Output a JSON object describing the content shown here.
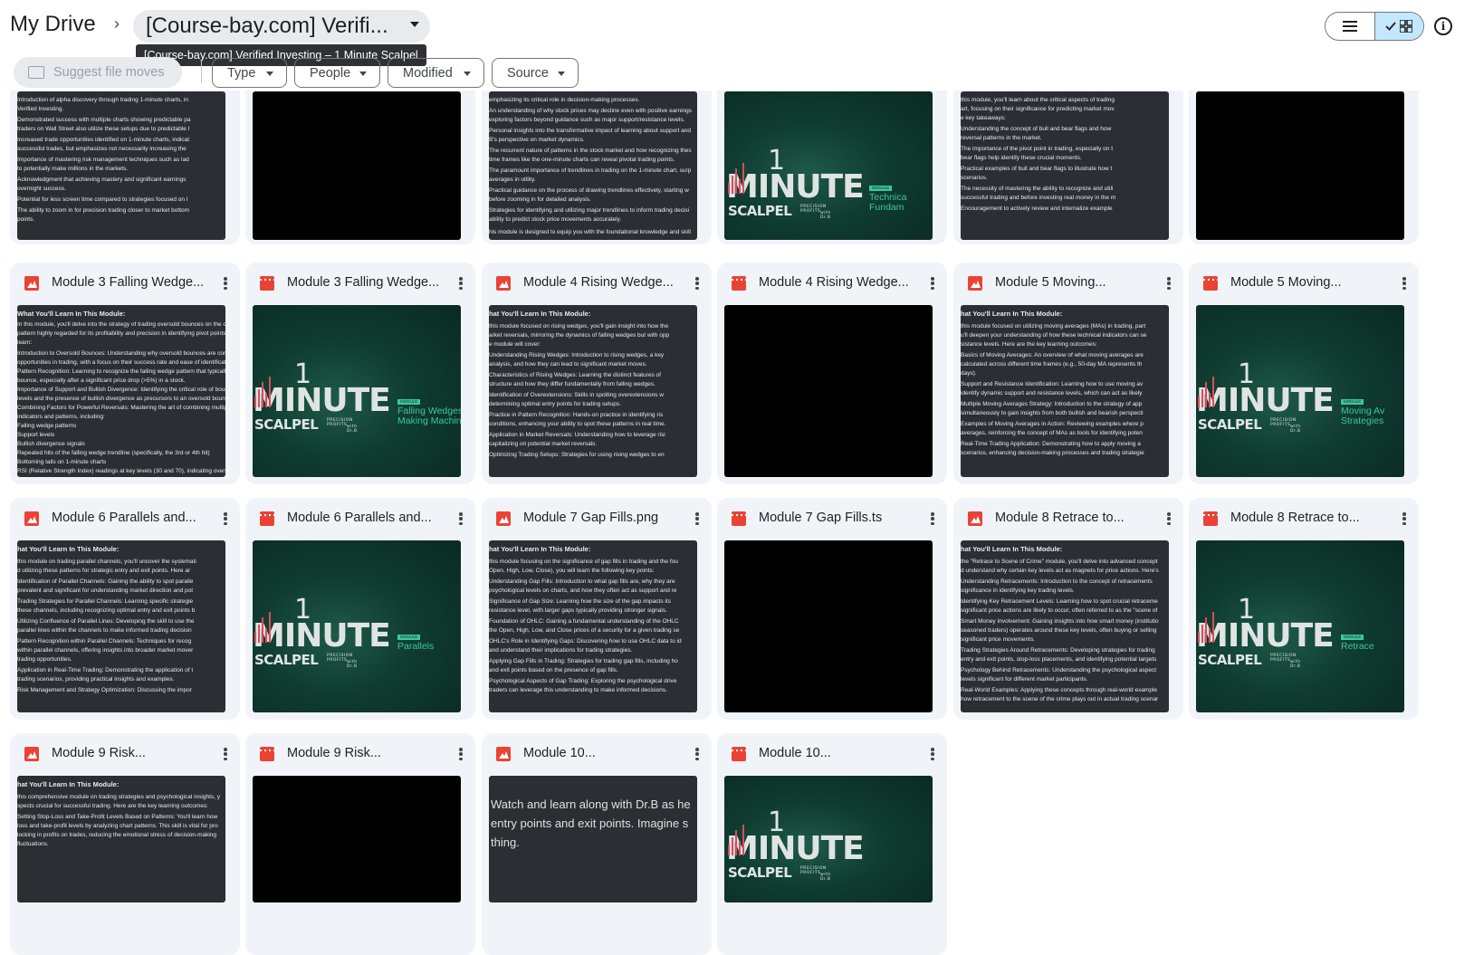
{
  "breadcrumb": {
    "root": "My Drive",
    "separator": "›",
    "current": "[Course-bay.com] Verifi...",
    "tooltip": "[Course-bay.com] Verified Investing – 1 Minute Scalpel"
  },
  "toolbar": {
    "suggest_label": "Suggest file moves",
    "filters": [
      "Type",
      "People",
      "Modified",
      "Source"
    ]
  },
  "logo": {
    "minute": "MINUTE",
    "scalpel": "SCALPEL",
    "precision": "PRECISION PROFITS",
    "with": "with Dr.B",
    "one": "1",
    "module_badge": "MODULE"
  },
  "rows": [
    {
      "cards": [
        {
          "name": "",
          "type": "image",
          "thumb": "text",
          "lines": [
            "Introduction of alpha discovery through trading 1-minute charts, in",
            "Verified Investing.",
            "",
            "Demonstrated success with multiple charts showing predictable pa",
            "traders on Wall Street also utilize these setups due to predictable l",
            "",
            "Increased trade opportunities identified on 1-minute charts, indicat",
            "successful trades, but emphasizes not necessarily increasing the",
            "",
            "Importance of mastering risk management techniques such as lad",
            "to potentially make millions in the markets.",
            "",
            "Acknowledgment that achieving mastery and significant earnings",
            "overnight success.",
            "",
            "Potential for less screen time compared to strategies focused on l",
            "",
            "The ability to zoom in for precision trading closer to market bottom",
            "points."
          ]
        },
        {
          "name": "",
          "type": "video",
          "thumb": "black"
        },
        {
          "name": "",
          "type": "image",
          "thumb": "text",
          "lines": [
            "emphasizing its critical role in decision-making processes.",
            "",
            "An understanding of why stock prices may decline even with positive earnings",
            "exploring factors beyond guidance such as major support/resistance levels.",
            "",
            "Personal insights into the transformative impact of learning about support and",
            "B's perspective on market dynamics.",
            "",
            "The recurrent nature of patterns in the stock market and how recognizing thes",
            "time frames like the one-minute charts can reveal pivotal trading points.",
            "",
            "The paramount importance of trendlines in trading on the 1-minute chart, surp",
            "averages in utility.",
            "",
            "Practical guidance on the process of drawing trendlines effectively, starting w",
            "before zooming in for detailed analysis.",
            "",
            "Strategies for identifying and utilizing major trendlines to inform trading decisi",
            "ability to predict stock price movements accurately.",
            "",
            "",
            "his module is designed to equip you with the foundational knowledge and skill"
          ]
        },
        {
          "name": "",
          "type": "video",
          "thumb": "logo",
          "tag": [
            "Technica",
            "Fundam"
          ]
        },
        {
          "name": "",
          "type": "image",
          "thumb": "text",
          "lines": [
            "this module, you'll learn about the critical aspects of trading",
            "art, focusing on their significance for predicting market mov",
            "e key takeaways:",
            "",
            "Understanding the concept of bull and bear flags and how",
            "reversal patterns in the market.",
            "",
            "The importance of the pivot point in trading, especially on t",
            "bear flags help identify these crucial moments.",
            "",
            "Practical examples of bull and bear flags to illustrate how t",
            "scenarios.",
            "",
            "The necessity of mastering the ability to recognize and utili",
            "successful trading and before investing real money in the m",
            "",
            "Encouragement to actively review and internalize example"
          ]
        },
        {
          "name": "",
          "type": "video",
          "thumb": "black"
        }
      ]
    },
    {
      "cards": [
        {
          "name": "Module 3 Falling Wedge...",
          "type": "image",
          "thumb": "text",
          "lines": [
            "What You'll Learn In This Module:",
            "In this module, you'll delve into the strategy of trading oversold bounces on the one-minute chart, a",
            "pattern highly regarded for its profitability and precision in identifying pivot points. Here's what you'll",
            "learn:",
            "",
            "Introduction to Oversold Bounces: Understanding why oversold bounces are considered lucrative",
            "opportunities in trading, with a focus on their success rate and ease of identification.",
            "Pattern Recognition: Learning to recognize the falling wedge pattern that typically signals an oversold",
            "bounce, especially after a significant price drop (>5%) in a stock.",
            "Importance of Support and Bullish Divergence: Identifying the critical role of bouncing off support",
            "levels and the presence of bullish divergence as precursors to an oversold bounce.",
            "Combining Factors for Powerful Reversals: Mastering the art of combining multiple technical",
            "indicators and patterns, including:",
            "  Falling wedge patterns",
            "  Support levels",
            "  Bullish divergence signals",
            "  Repeated hits of the falling wedge trendline (specifically, the 3rd or 4th hit)",
            "  Bottoming tails on 1-minute charts",
            "  RSI (Relative Strength Index) readings at key levels (30 and 70), indicating oversold or overbought",
            "  conditions",
            "Executing Trades with Precision: Developing the skill to execute trades with tight stop losses,",
            "allowing for precise entry and exit points, often pinpointing..."
          ]
        },
        {
          "name": "Module 3 Falling Wedge...",
          "type": "video",
          "thumb": "logo",
          "tag": [
            "Falling Wedges",
            "Making Machin"
          ]
        },
        {
          "name": "Module 4 Rising Wedge...",
          "type": "image",
          "thumb": "text",
          "lines": [
            "hat You'll Learn In This Module:",
            "",
            "this module focused on rising wedges, you'll gain insight into how the",
            "arket reversals, mirroring the dynamics of falling wedges but with opp",
            "e module will cover:",
            "",
            "Understanding Rising Wedges: Introduction to rising wedges, a key",
            "analysis, and how they can lead to significant market moves.",
            "",
            "Characteristics of Rising Wedges: Learning the distinct features of",
            "structure and how they differ fundamentally from falling wedges.",
            "",
            "Identification of Overextensions: Skills in spotting overextensions w",
            "determining optimal entry points for trading setups.",
            "",
            "Practice in Pattern Recognition: Hands-on practice in identifying ris",
            "conditions, enhancing your ability to spot these patterns in real time.",
            "",
            "Application in Market Reversals: Understanding how to leverage risi",
            "capitalizing on potential market reversals.",
            "",
            "Optimizing Trading Setups: Strategies for using rising wedges to en"
          ]
        },
        {
          "name": "Module 4 Rising Wedge...",
          "type": "video",
          "thumb": "black"
        },
        {
          "name": "Module 5 Moving...",
          "type": "image",
          "thumb": "text",
          "lines": [
            "hat You'll Learn In This Module:",
            "",
            "this module focused on utilizing moving averages (MAs) in trading, part",
            "u'll deepen your understanding of how these technical indicators can se",
            "sistance levels. Here are the key learning outcomes:",
            "",
            "Basics of Moving Averages: An overview of what moving averages are",
            "calculated across different time frames (e.g., 50-day MA represents th",
            "days).",
            "",
            "Support and Resistance Identification: Learning how to use moving av",
            "identify dynamic support and resistance levels, which can act as likely",
            "",
            "Multiple Moving Averages Strategy: Introduction to the strategy of app",
            "simultaneously to gain insights from both bullish and bearish perspecti",
            "",
            "Examples of Moving Averages in Action: Reviewing examples where p",
            "averages, reinforcing the concept of MAs as tools for identifying poten",
            "",
            "Real-Time Trading Application: Demonstrating how to apply moving a",
            "scenarios, enhancing decision-making processes and trading strategie"
          ]
        },
        {
          "name": "Module 5 Moving...",
          "type": "video",
          "thumb": "logo",
          "tag": [
            "Moving Av",
            "Strategies"
          ]
        }
      ]
    },
    {
      "cards": [
        {
          "name": "Module 6 Parallels and...",
          "type": "image",
          "thumb": "text",
          "lines": [
            "hat You'll Learn In This Module:",
            "",
            "this module on trading parallel channels, you'll uncover the systemati",
            "d utilizing these patterns for strategic entry and exit points. Here ar",
            "",
            "Identification of Parallel Channels: Gaining the ability to spot paralle",
            "prevalent and significant for understanding market direction and pot",
            "",
            "Trading Strategies for Parallel Channels: Learning specific strategie",
            "these channels, including recognizing optimal entry and exit points b",
            "",
            "Utilizing Confluence of Parallel Lines: Developing the skill to use the",
            "parallel lines within the channels to make informed trading decision",
            "",
            "Pattern Recognition within Parallel Channels: Techniques for recog",
            "within parallel channels, offering insights into broader market mover",
            "trading opportunities.",
            "",
            "Application in Real-Time Trading: Demonstrating the application of t",
            "trading scenarios, providing practical insights and examples.",
            "",
            "Risk Management and Strategy Optimization: Discussing the impor"
          ]
        },
        {
          "name": "Module 6 Parallels and...",
          "type": "video",
          "thumb": "logo",
          "tag": [
            "Parallels"
          ]
        },
        {
          "name": "Module 7 Gap Fills.png",
          "type": "image",
          "thumb": "text",
          "lines": [
            "hat You'll Learn In This Module:",
            "",
            "this module focusing on the significance of gap fills in trading and the fou",
            "Open, High, Low, Close), you will learn the following key points:",
            "",
            "Understanding Gap Fills: Introduction to what gap fills are, why they are",
            "psychological levels on charts, and how they often act as support and re",
            "",
            "Significance of Gap Size: Learning how the size of the gap impacts its",
            "resistance level, with larger gaps typically providing stronger signals.",
            "",
            "Foundation of OHLC: Gaining a fundamental understanding of the OHLC",
            "the Open, High, Low, and Close prices of a security for a given trading se",
            "",
            "OHLC's Role in Identifying Gaps: Discovering how to use OHLC data to id",
            "and understand their implications for trading strategies.",
            "",
            "Applying Gap Fills in Trading: Strategies for trading gap fills, including ho",
            "and exit points based on the presence of gap fills.",
            "",
            "Psychological Aspects of Gap Trading: Exploring the psychological drive",
            "traders can leverage this understanding to make informed decisions."
          ]
        },
        {
          "name": "Module 7 Gap Fills.ts",
          "type": "video",
          "thumb": "black"
        },
        {
          "name": "Module 8 Retrace to...",
          "type": "image",
          "thumb": "text",
          "lines": [
            "hat You'll Learn In This Module:",
            "",
            "the \"Retrace to Scene of Crime\" module, you'll delve into advanced concept",
            "d understand why certain key levels act as magnets for price actions. Here's",
            "",
            "Understanding Retracements: Introduction to the concept of retracements",
            "significance in identifying key trading levels.",
            "",
            "Identifying Key Retracement Levels: Learning how to spot crucial retraceme",
            "significant price actions are likely to occur, often referred to as the \"scene of",
            "",
            "Smart Money Involvement: Gaining insights into how smart money (institutio",
            "seasoned traders) operates around these key levels, often buying or selling",
            "significant price movements.",
            "",
            "Trading Strategies Around Retracements: Developing strategies for trading",
            "entry and exit points, stop-loss placements, and identifying potential targets",
            "",
            "Psychology Behind Retracements: Understanding the psychological aspect",
            "levels significant for different market participants.",
            "",
            "Real-World Examples: Applying these concepts through real-world example",
            "how retracement to the scene of the crime plays out in actual trading scenar"
          ]
        },
        {
          "name": "Module 8 Retrace to...",
          "type": "video",
          "thumb": "logo",
          "tag": [
            "Retrace"
          ]
        }
      ]
    },
    {
      "cards": [
        {
          "name": "Module 9 Risk...",
          "type": "image",
          "thumb": "text",
          "lines": [
            "hat You'll Learn In This Module:",
            "",
            "this comprehensive module on trading strategies and psychological insights, y",
            "spects crucial for successful trading. Here are the key learning outcomes:",
            "",
            "Setting Stop-Loss and Take-Profit Levels Based on Patterns: You'll learn how",
            "loss and take-profit levels by analyzing chart patterns. This skill is vital for pro",
            "locking in profits on trades, reducing the emotional stress of decision-making",
            "fluctuations."
          ]
        },
        {
          "name": "Module 9 Risk...",
          "type": "video",
          "thumb": "black"
        },
        {
          "name": "Module 10...",
          "type": "image",
          "thumb": "bigtext",
          "lines": [
            "Watch and learn along with Dr.B as he",
            "entry points and exit points. Imagine s",
            "thing."
          ]
        },
        {
          "name": "Module 10...",
          "type": "video",
          "thumb": "logo-partial"
        }
      ]
    }
  ]
}
